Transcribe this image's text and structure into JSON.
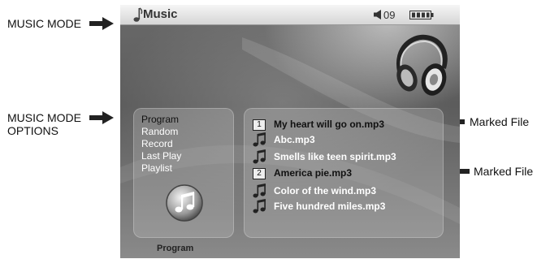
{
  "annotations": {
    "music_mode": "MUSIC MODE",
    "music_mode_options_1": "MUSIC MODE",
    "music_mode_options_2": "OPTIONS",
    "marked_file_1": "Marked File",
    "marked_file_2": "Marked File"
  },
  "status_bar": {
    "title": "Music",
    "volume": "09",
    "icons": [
      "music-note-icon",
      "speaker-icon",
      "battery-icon"
    ]
  },
  "options_menu": {
    "items": [
      "Program",
      "Random",
      "Record",
      "Last Play",
      "Playlist"
    ],
    "selected": "Program",
    "icon": "music-note-disc-icon"
  },
  "files": [
    {
      "marker": "1",
      "name": "My heart will go on.mp3"
    },
    {
      "marker": "",
      "name": "Abc.mp3"
    },
    {
      "marker": "",
      "name": "Smells like teen spirit.mp3"
    },
    {
      "marker": "2",
      "name": "America pie.mp3"
    },
    {
      "marker": "",
      "name": "Color of the wind.mp3"
    },
    {
      "marker": "",
      "name": "Five hundred miles.mp3"
    }
  ],
  "footer": {
    "mode_label": "Program"
  },
  "decor": {
    "headphones_icon": "headphones-icon"
  },
  "colors": {
    "arrow": "#222222",
    "panel_text": "#ffffff",
    "marked_text": "#111111"
  }
}
